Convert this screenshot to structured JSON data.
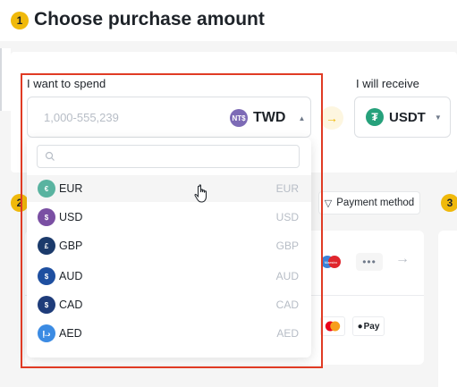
{
  "header": {
    "step": "1",
    "title": "Choose purchase amount"
  },
  "spend": {
    "label": "I want to spend",
    "placeholder": "1,000-555,239",
    "currency": {
      "code": "TWD",
      "icon_text": "NT$",
      "color": "#7d6bb6"
    }
  },
  "receive": {
    "label": "I will receive",
    "currency": {
      "code": "USDT",
      "icon_text": "₮",
      "color": "#26a17b"
    }
  },
  "currency_search": {
    "placeholder": ""
  },
  "currency_options": [
    {
      "code": "EUR",
      "alt": "EUR",
      "icon_text": "€",
      "color": "#59b3a0"
    },
    {
      "code": "USD",
      "alt": "USD",
      "icon_text": "$",
      "color": "#7a4fa3"
    },
    {
      "code": "GBP",
      "alt": "GBP",
      "icon_text": "£",
      "color": "#1b3a6b"
    },
    {
      "code": "AUD",
      "alt": "AUD",
      "icon_text": "$",
      "color": "#1e4fa0"
    },
    {
      "code": "CAD",
      "alt": "CAD",
      "icon_text": "$",
      "color": "#1e3c7a"
    },
    {
      "code": "AED",
      "alt": "AED",
      "icon_text": "د.إ",
      "color": "#3b8be3"
    }
  ],
  "steps": {
    "two": "2",
    "three": "3"
  },
  "payment": {
    "filter_label": "Payment method",
    "maestro_text": "Maestro",
    "more_text": "•••",
    "applepay_text": "Pay"
  },
  "colors": {
    "accent": "#f0b90b",
    "highlight": "#e03b24"
  }
}
